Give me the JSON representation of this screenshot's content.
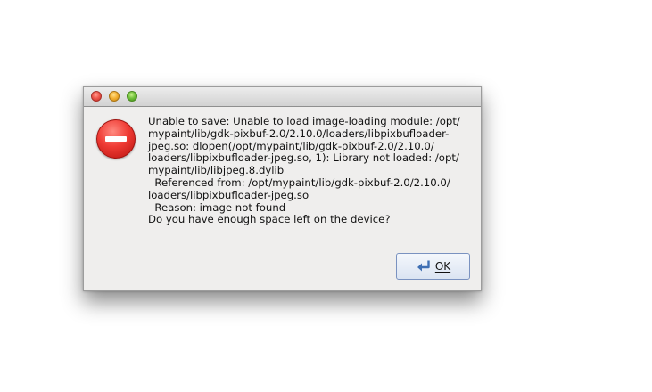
{
  "window": {
    "title": "",
    "controls": [
      "close",
      "minimize",
      "zoom"
    ]
  },
  "dialog": {
    "icon": "stop-icon",
    "message": "Unable to save: Unable to load image-loading module: /opt/\nmypaint/lib/gdk-pixbuf-2.0/2.10.0/loaders/libpixbufloader-\njpeg.so: dlopen(/opt/mypaint/lib/gdk-pixbuf-2.0/2.10.0/\nloaders/libpixbufloader-jpeg.so, 1): Library not loaded: /opt/\nmypaint/lib/libjpeg.8.dylib\n  Referenced from: /opt/mypaint/lib/gdk-pixbuf-2.0/2.10.0/\nloaders/libpixbufloader-jpeg.so\n  Reason: image not found\nDo you have enough space left on the device?",
    "ok_label": "OK",
    "ok_icon": "enter-icon"
  },
  "colors": {
    "stop": "#e53a32",
    "button_border": "#7a92c0"
  }
}
